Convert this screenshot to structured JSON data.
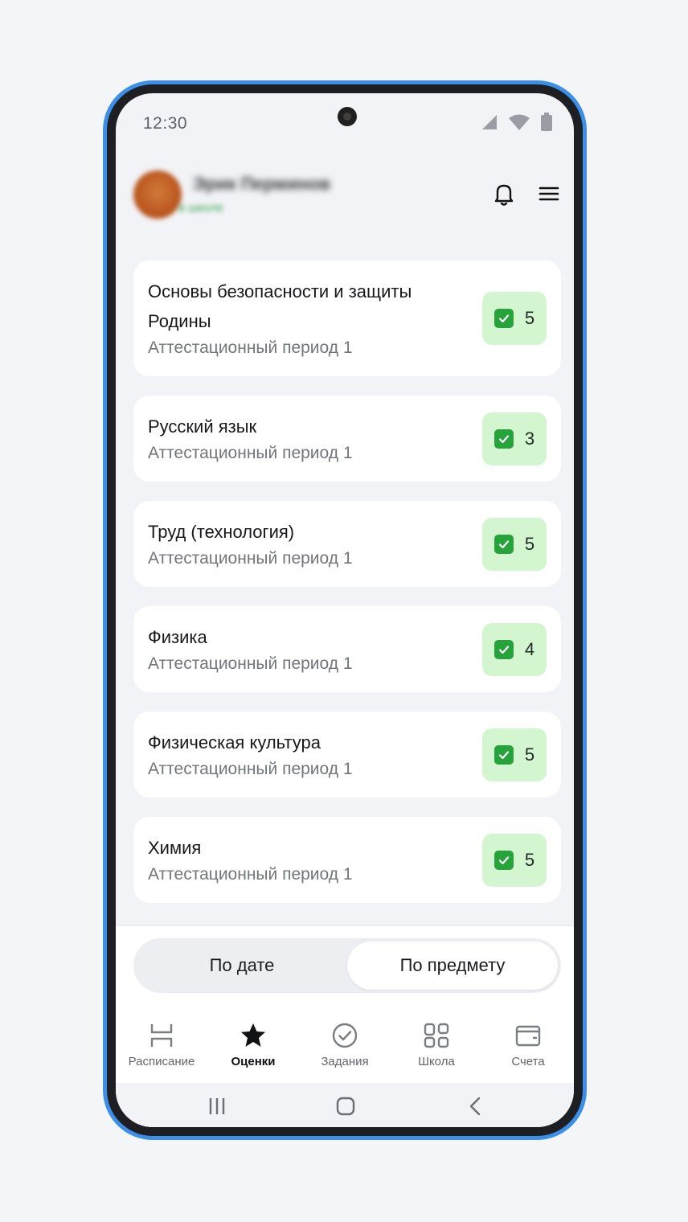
{
  "status_bar": {
    "time": "12:30"
  },
  "header": {
    "user_name": "Эрик Перминов",
    "user_status": "в школе"
  },
  "grades": [
    {
      "subject": "Основы безопасности и защиты Родины",
      "period": "Аттестационный период 1",
      "grade": "5"
    },
    {
      "subject": "Русский язык",
      "period": "Аттестационный период 1",
      "grade": "3"
    },
    {
      "subject": "Труд (технология)",
      "period": "Аттестационный период 1",
      "grade": "5"
    },
    {
      "subject": "Физика",
      "period": "Аттестационный период 1",
      "grade": "4"
    },
    {
      "subject": "Физическая культура",
      "period": "Аттестационный период 1",
      "grade": "5"
    },
    {
      "subject": "Химия",
      "period": "Аттестационный период 1",
      "grade": "5"
    }
  ],
  "sort_toggle": {
    "by_date": "По дате",
    "by_subject": "По предмету",
    "selected": "by_subject"
  },
  "tabs": [
    {
      "label": "Расписание",
      "icon": "schedule-icon"
    },
    {
      "label": "Оценки",
      "icon": "star-icon"
    },
    {
      "label": "Задания",
      "icon": "check-circle-icon"
    },
    {
      "label": "Школа",
      "icon": "grid-icon"
    },
    {
      "label": "Счета",
      "icon": "wallet-icon"
    }
  ],
  "active_tab": "Оценки",
  "colors": {
    "phone_frame_accent": "#3b8fe8",
    "grade_badge_bg": "#d3f5d0",
    "grade_check": "#26a33a"
  }
}
